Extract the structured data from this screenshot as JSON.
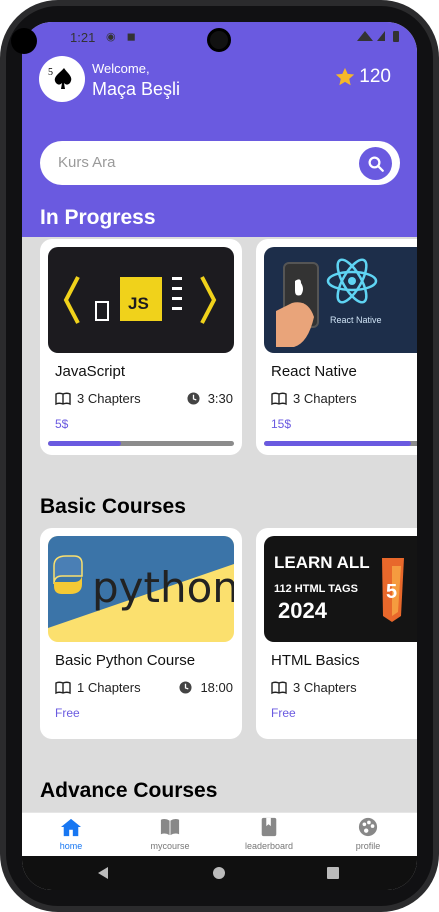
{
  "status": {
    "time": "1:21"
  },
  "header": {
    "welcome": "Welcome,",
    "username": "Maça Beşli",
    "points": "120"
  },
  "search": {
    "placeholder": "Kurs Ara"
  },
  "sections": {
    "in_progress": "In Progress",
    "basic": "Basic Courses",
    "advance": "Advance Courses"
  },
  "in_progress": [
    {
      "title": "JavaScript",
      "chapters": "3 Chapters",
      "duration": "3:30",
      "price": "5$",
      "progress": 0.39,
      "thumb_text": "JS"
    },
    {
      "title": "React Native",
      "chapters": "3 Chapters",
      "duration": "",
      "price": "15$",
      "progress": 0.79,
      "thumb_text": "React Native"
    }
  ],
  "basic": [
    {
      "title": "Basic Python Course",
      "chapters": "1 Chapters",
      "duration": "18:00",
      "price": "Free",
      "thumb_text": "python"
    },
    {
      "title": "HTML Basics",
      "chapters": "3 Chapters",
      "duration": "",
      "price": "Free",
      "thumb_text_1": "LEARN ALL",
      "thumb_text_2": "112 HTML TAGS",
      "thumb_text_3": "2024"
    }
  ],
  "nav": {
    "home": "home",
    "mycourse": "mycourse",
    "leaderboard": "leaderboard",
    "profile": "profile"
  },
  "colors": {
    "accent": "#6a5ae0",
    "nav_active": "#1877f2",
    "background": "#dcdcdc"
  }
}
